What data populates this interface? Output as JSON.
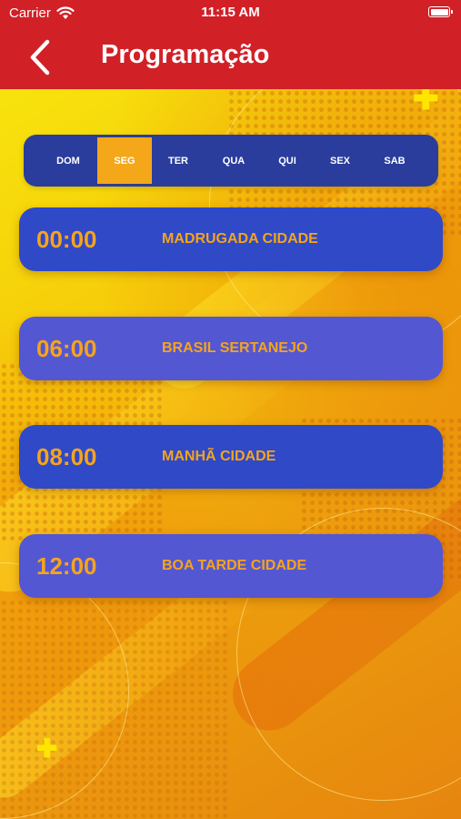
{
  "status_bar": {
    "carrier": "Carrier",
    "time": "11:15 AM",
    "wifi_icon": "wifi-icon",
    "battery_icon": "battery-icon"
  },
  "nav": {
    "back_icon": "chevron-left-icon",
    "title": "Programação"
  },
  "day_tabs": {
    "selected": "SEG",
    "items": [
      {
        "label": "DOM"
      },
      {
        "label": "SEG"
      },
      {
        "label": "TER"
      },
      {
        "label": "QUA"
      },
      {
        "label": "QUI"
      },
      {
        "label": "SEX"
      },
      {
        "label": "SAB"
      }
    ]
  },
  "schedule": [
    {
      "time": "00:00",
      "program": "MADRUGADA CIDADE"
    },
    {
      "time": "06:00",
      "program": "BRASIL SERTANEJO"
    },
    {
      "time": "08:00",
      "program": "MANHÃ CIDADE"
    },
    {
      "time": "12:00",
      "program": "BOA TARDE CIDADE"
    }
  ],
  "colors": {
    "header_red": "#d22027",
    "tabs_bg": "#2a3d9c",
    "tab_active": "#f5a71a",
    "card_dark": "#3049c6",
    "card_light": "#5457d2",
    "card_text": "#f5a41c"
  }
}
